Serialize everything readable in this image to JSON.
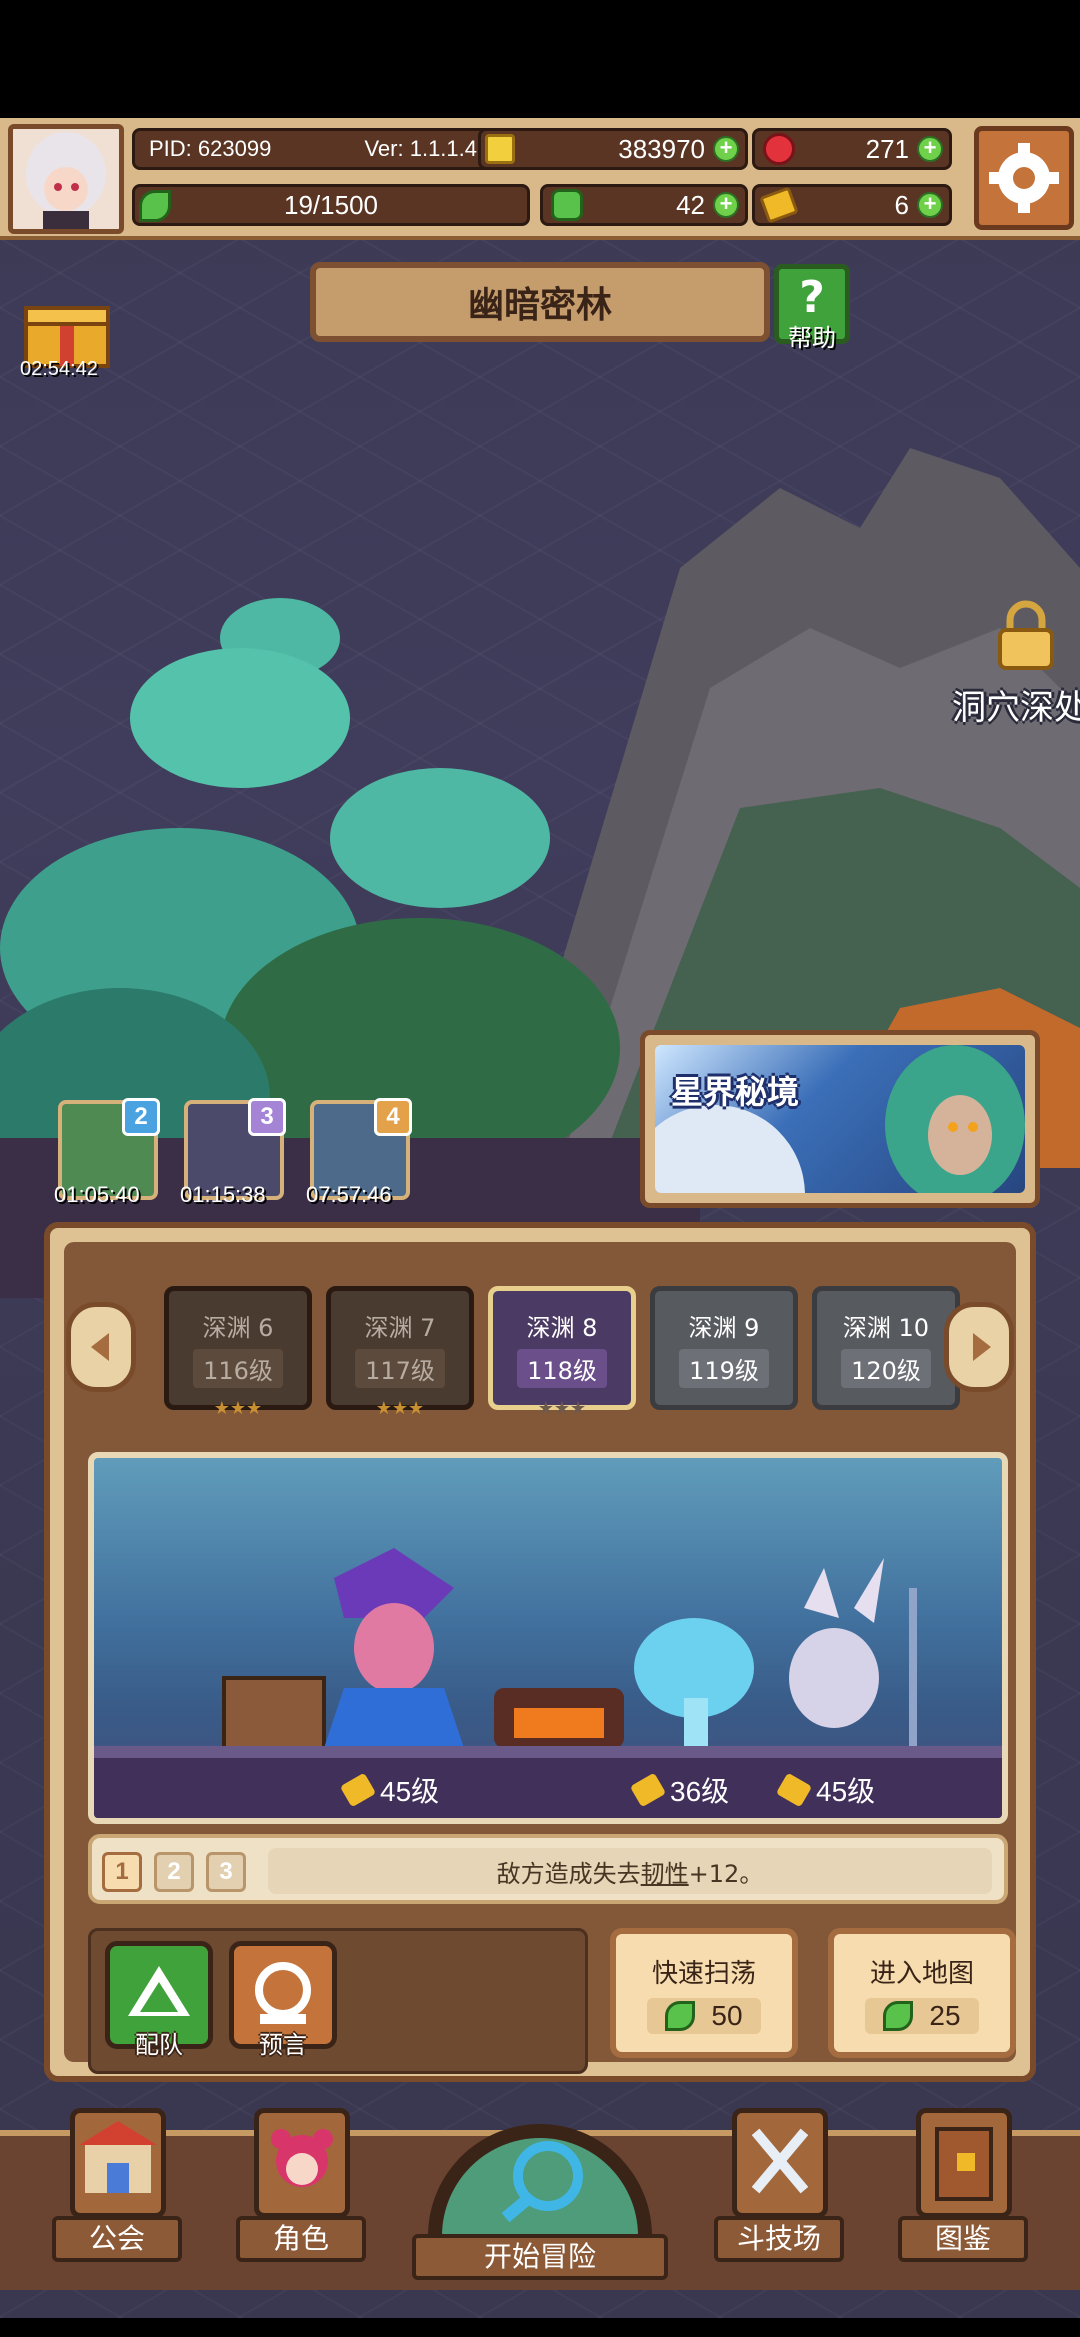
{
  "player": {
    "pid": "PID: 623099",
    "version": "Ver: 1.1.1.4",
    "gold": "383970",
    "gems": "271",
    "stamina": "19/1500",
    "clover": "42",
    "keys": "6"
  },
  "gift_timer": "02:54:42",
  "region": {
    "title": "幽暗密林",
    "help_label": "帮助",
    "locked_area": "洞穴深处"
  },
  "mini_stages": [
    {
      "num": "2",
      "timer": "01:05:40",
      "color": "#4aa3e0"
    },
    {
      "num": "3",
      "timer": "01:15:38",
      "color": "#a584d6"
    },
    {
      "num": "4",
      "timer": "07:57:46",
      "color": "#e3a24a"
    }
  ],
  "star_realm": "星界秘境",
  "stages": [
    {
      "name": "深渊 6",
      "level": "116级",
      "stars": "★★★",
      "state": "cleared"
    },
    {
      "name": "深渊 7",
      "level": "117级",
      "stars": "★★★",
      "state": "cleared"
    },
    {
      "name": "深渊 8",
      "level": "118级",
      "stars": "★★★",
      "state": "current"
    },
    {
      "name": "深渊 9",
      "level": "119级",
      "stars": "",
      "state": "locked"
    },
    {
      "name": "深渊 10",
      "level": "120级",
      "stars": "",
      "state": "locked"
    }
  ],
  "enemy_levels": [
    "45级",
    "36级",
    "45级"
  ],
  "tip": {
    "pages": [
      "1",
      "2",
      "3"
    ],
    "text_before": "敌方造成失去",
    "keyword": "韧性",
    "text_after": "+12。"
  },
  "actions": {
    "team_label": "配队",
    "forecast_label": "预言",
    "sweep_title": "快速扫荡",
    "sweep_cost": "50",
    "enter_title": "进入地图",
    "enter_cost": "25"
  },
  "nav": {
    "guild": "公会",
    "character": "角色",
    "adventure": "开始冒险",
    "arena": "斗技场",
    "codex": "图鉴"
  }
}
